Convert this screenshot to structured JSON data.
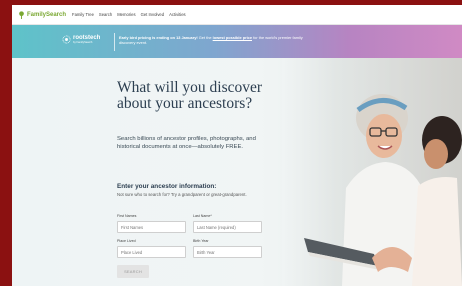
{
  "nav": {
    "logo_text": "FamilySearch",
    "links": [
      "Family Tree",
      "Search",
      "Memories",
      "Get Involved",
      "Activities"
    ]
  },
  "banner": {
    "logo_name": "rootstech",
    "logo_sub": "by FamilySearch",
    "bold_text": "Early bird pricing is ending on 13 January!",
    "text_before_link": " Get the ",
    "link_text": "lowest possible price",
    "text_after_link": " for the world's premier family discovery event."
  },
  "hero": {
    "title": "What will you discover about your ancestors?",
    "description": "Search billions of ancestor profiles, photographs, and historical documents at once—absolutely FREE."
  },
  "form": {
    "title": "Enter your ancestor information:",
    "help": "Not sure who to search for? Try a grandparent or great-grandparent.",
    "first_name_label": "First Names",
    "first_name_placeholder": "First Names",
    "last_name_label": "Last Name*",
    "last_name_placeholder": "Last Name (required)",
    "place_label": "Place Lived",
    "place_placeholder": "Place Lived",
    "birth_label": "Birth Year",
    "birth_placeholder": "Birth Year",
    "search_label": "SEARCH"
  },
  "colors": {
    "brand_green": "#7aa832",
    "frame_red": "#8b1111",
    "title_navy": "#2c3e50"
  }
}
